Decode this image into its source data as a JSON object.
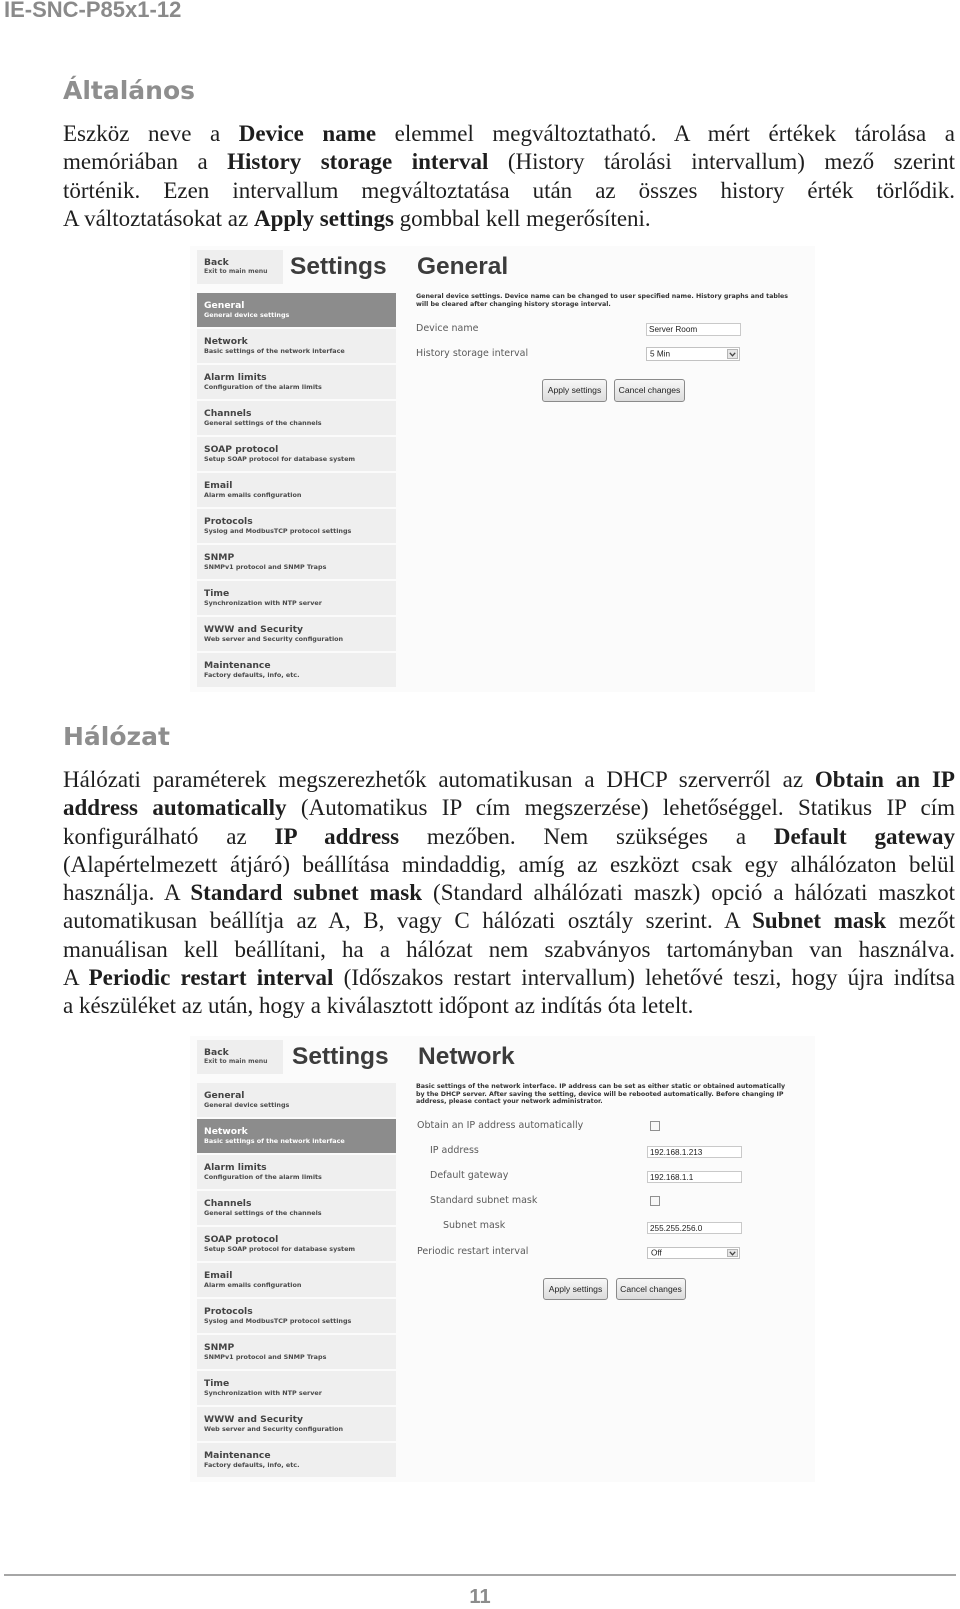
{
  "document": {
    "header_code": "IE-SNC-P85x1-12",
    "page_number": "11"
  },
  "sections": {
    "general": {
      "heading": "Általános",
      "lines": [
        [
          {
            "text": "Eszköz neve a ",
            "bold": false
          },
          {
            "text": "Device name",
            "bold": true
          },
          {
            "text": " elemmel megváltoztatható. A mért értékek tárolása a",
            "bold": false
          }
        ],
        [
          {
            "text": "memóriában a ",
            "bold": false
          },
          {
            "text": "History storage interval",
            "bold": true
          },
          {
            "text": " (History tárolási intervallum) mező szerint",
            "bold": false
          }
        ],
        [
          {
            "text": "történik. Ezen intervallum megváltoztatása után az összes history érték törlődik.",
            "bold": false
          }
        ],
        [
          {
            "text": "A változtatásokat az ",
            "bold": false
          },
          {
            "text": "Apply settings",
            "bold": true
          },
          {
            "text": " gombbal kell megerősíteni.",
            "bold": false
          }
        ]
      ]
    },
    "network": {
      "heading": "Hálózat",
      "lines": [
        [
          {
            "text": "Hálózati paraméterek megszerezhetők automatikusan a DHCP szerverről az ",
            "bold": false
          },
          {
            "text": "Obtain an IP",
            "bold": true
          }
        ],
        [
          {
            "text": "address automatically",
            "bold": true
          },
          {
            "text": " (Automatikus IP cím megszerzése) lehetőséggel. Statikus IP cím",
            "bold": false
          }
        ],
        [
          {
            "text": "konfigurálható az ",
            "bold": false
          },
          {
            "text": "IP address",
            "bold": true
          },
          {
            "text": " mezőben. Nem szükséges a ",
            "bold": false
          },
          {
            "text": "Default gateway",
            "bold": true
          }
        ],
        [
          {
            "text": "(Alapértelmezett átjáró) beállítása mindaddig, amíg az eszközt csak egy alhálózaton belül",
            "bold": false
          }
        ],
        [
          {
            "text": "használja. A ",
            "bold": false
          },
          {
            "text": "Standard subnet mask",
            "bold": true
          },
          {
            "text": " (Standard alhálózati maszk) opció a hálózati maszkot",
            "bold": false
          }
        ],
        [
          {
            "text": "automatikusan beállítja az A, B, vagy C hálózati osztály szerint. A ",
            "bold": false
          },
          {
            "text": "Subnet mask",
            "bold": true
          },
          {
            "text": " mezőt",
            "bold": false
          }
        ],
        [
          {
            "text": "manuálisan kell beállítani, ha a hálózat nem szabványos tartományban van használva.",
            "bold": false
          }
        ],
        [
          {
            "text": "A ",
            "bold": false
          },
          {
            "text": "Periodic restart interval",
            "bold": true
          },
          {
            "text": " (Időszakos restart intervallum) lehetővé teszi, hogy újra indítsa",
            "bold": false
          }
        ],
        [
          {
            "text": "a készüléket az után, hogy a kiválasztott időpont az indítás óta letelt.",
            "bold": false
          }
        ]
      ]
    }
  },
  "screenshots": {
    "general": {
      "back_label": "Back",
      "back_sublabel": "Exit to main menu",
      "settings_title": "Settings",
      "page_heading": "General",
      "description_lines": [
        "General device settings. Device name can be changed to user specified name. History graphs and tables",
        "will be cleared after changing history storage interval."
      ],
      "active_item": "General",
      "menu": [
        {
          "label": "General",
          "description": "General device settings"
        },
        {
          "label": "Network",
          "description": "Basic settings of the network interface"
        },
        {
          "label": "Alarm limits",
          "description": "Configuration of the alarm limits"
        },
        {
          "label": "Channels",
          "description": "General settings of the channels"
        },
        {
          "label": "SOAP protocol",
          "description": "Setup SOAP protocol for database system"
        },
        {
          "label": "Email",
          "description": "Alarm emails configuration"
        },
        {
          "label": "Protocols",
          "description": "Syslog and ModbusTCP protocol settings"
        },
        {
          "label": "SNMP",
          "description": "SNMPv1 protocol and SNMP Traps"
        },
        {
          "label": "Time",
          "description": "Synchronization with NTP server"
        },
        {
          "label": "WWW and Security",
          "description": "Web server and Security configuration"
        },
        {
          "label": "Maintenance",
          "description": "Factory defaults, info, etc."
        }
      ],
      "fields": {
        "device_name": {
          "label": "Device name",
          "value": "Server Room"
        },
        "history_storage_interval": {
          "label": "History storage interval",
          "value": "5 Min"
        }
      },
      "apply_label": "Apply settings",
      "cancel_label": "Cancel changes"
    },
    "network": {
      "back_label": "Back",
      "back_sublabel": "Exit to main menu",
      "settings_title": "Settings",
      "page_heading": "Network",
      "description_lines": [
        "Basic settings of the network interface. IP address can be set as either static or obtained automatically",
        "by the DHCP server. After saving the setting, device will be rebooted automatically. Before changing IP",
        "address, please contact your network administrator."
      ],
      "active_item": "Network",
      "menu": [
        {
          "label": "General",
          "description": "General device settings"
        },
        {
          "label": "Network",
          "description": "Basic settings of the network interface"
        },
        {
          "label": "Alarm limits",
          "description": "Configuration of the alarm limits"
        },
        {
          "label": "Channels",
          "description": "General settings of the channels"
        },
        {
          "label": "SOAP protocol",
          "description": "Setup SOAP protocol for database system"
        },
        {
          "label": "Email",
          "description": "Alarm emails configuration"
        },
        {
          "label": "Protocols",
          "description": "Syslog and ModbusTCP protocol settings"
        },
        {
          "label": "SNMP",
          "description": "SNMPv1 protocol and SNMP Traps"
        },
        {
          "label": "Time",
          "description": "Synchronization with NTP server"
        },
        {
          "label": "WWW and Security",
          "description": "Web server and Security configuration"
        },
        {
          "label": "Maintenance",
          "description": "Factory defaults, info, etc."
        }
      ],
      "fields": {
        "obtain_ip_automatically": {
          "label": "Obtain an IP address automatically",
          "checked": false
        },
        "ip_address": {
          "label": "IP address",
          "value": "192.168.1.213"
        },
        "default_gateway": {
          "label": "Default gateway",
          "value": "192.168.1.1"
        },
        "standard_subnet_mask": {
          "label": "Standard subnet mask",
          "checked": false
        },
        "subnet_mask": {
          "label": "Subnet mask",
          "value": "255.255.256.0"
        },
        "periodic_restart_interval": {
          "label": "Periodic restart interval",
          "value": "Off"
        }
      },
      "apply_label": "Apply settings",
      "cancel_label": "Cancel changes"
    }
  }
}
